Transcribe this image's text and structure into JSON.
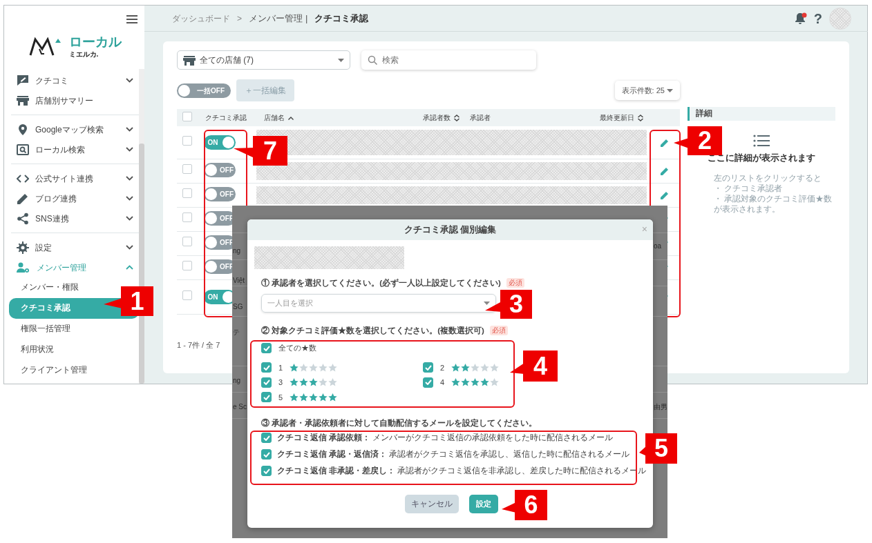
{
  "sidebar": {
    "logo": {
      "main": "ローカル",
      "sub": "ミエルカ."
    },
    "groups": [
      [
        {
          "label": "クチコミ",
          "kind": "menu",
          "expanded": false
        },
        {
          "label": "店舗別サマリー",
          "kind": "link",
          "expanded": false
        }
      ],
      [
        {
          "label": "Googleマップ検索",
          "kind": "menu",
          "expanded": false
        },
        {
          "label": "ローカル検索",
          "kind": "menu",
          "expanded": false
        }
      ],
      [
        {
          "label": "公式サイト連携",
          "kind": "menu",
          "expanded": false
        },
        {
          "label": "ブログ連携",
          "kind": "menu",
          "expanded": false
        },
        {
          "label": "SNS連携",
          "kind": "menu",
          "expanded": false
        }
      ],
      [
        {
          "label": "設定",
          "kind": "menu",
          "expanded": false
        },
        {
          "label": "メンバー管理",
          "kind": "menu",
          "expanded": true
        }
      ]
    ],
    "submenu": [
      {
        "label": "メンバー・権限",
        "selected": false
      },
      {
        "label": "クチコミ承認",
        "selected": true
      },
      {
        "label": "権限一括管理",
        "selected": false
      },
      {
        "label": "利用状況",
        "selected": false
      },
      {
        "label": "クライアント管理",
        "selected": false
      }
    ]
  },
  "header": {
    "breadcrumb": [
      {
        "label": "ダッシュボード"
      },
      {
        "label": "メンバー管理"
      }
    ],
    "separator": ">",
    "divider": "|",
    "current": "クチコミ承認",
    "has_notification": true,
    "help": "?"
  },
  "toolbar": {
    "store_select": "全ての店舗 (7)",
    "search": {
      "placeholder": "検索"
    },
    "bulk_toggle": {
      "label": "一括OFF",
      "on": false
    },
    "bulk_edit": {
      "label": "＋一括編集",
      "disabled": true
    },
    "page_size": "表示件数: 25"
  },
  "table": {
    "all_checked": false,
    "columns": [
      {
        "label": "クチコミ承認"
      },
      {
        "label": "店舗名"
      },
      {
        "label": "承認者数"
      },
      {
        "label": "承認者"
      },
      {
        "label": "最終更新日"
      }
    ],
    "rows": [
      {
        "checked": false,
        "approval": {
          "label": "ON",
          "on": true
        }
      },
      {
        "checked": false,
        "approval": {
          "label": "OFF",
          "on": false
        }
      },
      {
        "checked": false,
        "approval": {
          "label": "OFF",
          "on": false
        }
      },
      {
        "checked": false,
        "approval": {
          "label": "OFF",
          "on": false
        }
      },
      {
        "checked": false,
        "approval": {
          "label": "OFF",
          "on": false
        }
      },
      {
        "checked": false,
        "approval": {
          "label": "OFF",
          "on": false
        }
      },
      {
        "checked": false,
        "approval": {
          "label": "ON",
          "on": true
        }
      }
    ],
    "footer": "1 - 7件 / 全 7"
  },
  "detail": {
    "title": "詳細",
    "message": "ここに詳細が表示されます",
    "hint": [
      "左のリストをクリックすると",
      "・ クチコミ承認者",
      "・ 承認対象のクチコミ評価★数",
      "が表示されます。"
    ]
  },
  "backdrop": {
    "left": [
      "ng",
      "Việt",
      "SG",
      "テ",
      "ng",
      "e Sc"
    ],
    "right": [
      "oa",
      "由男"
    ]
  },
  "modal": {
    "title": "クチコミ承認 個別編集",
    "close": "×",
    "approver": {
      "heading": "① 承認者を選択してください。(必ず一人以上設定してください)",
      "badge": "必須",
      "placeholder": "一人目を選択"
    },
    "rating": {
      "heading": "② 対象クチコミ評価★数を選択してください。(複数選択可)",
      "badge": "必須",
      "all": {
        "label": "全ての★数",
        "checked": true
      },
      "options": [
        {
          "label": "1",
          "checked": true,
          "stars": 1
        },
        {
          "label": "2",
          "checked": true,
          "stars": 2
        },
        {
          "label": "3",
          "checked": true,
          "stars": 3
        },
        {
          "label": "4",
          "checked": true,
          "stars": 4
        },
        {
          "label": "5",
          "checked": true,
          "stars": 5
        }
      ]
    },
    "mail": {
      "heading": "③ 承認者・承認依頼者に対して自動配信するメールを設定してください。",
      "options": [
        {
          "title": "クチコミ返信 承認依頼：",
          "description": "メンバーがクチコミ返信の承認依頼をした時に配信されるメール",
          "checked": true
        },
        {
          "title": "クチコミ返信 承認・返信済：",
          "description": "承認者がクチコミ返信を承認し、返信した時に配信されるメール",
          "checked": true
        },
        {
          "title": "クチコミ返信 非承認・差戻し：",
          "description": "承認者がクチコミ返信を非承認し、差戻した時に配信されるメール",
          "checked": true
        }
      ]
    },
    "buttons": {
      "cancel": "キャンセル",
      "ok": "設定"
    }
  },
  "callouts": [
    {
      "number": "1"
    },
    {
      "number": "2"
    },
    {
      "number": "3"
    },
    {
      "number": "4"
    },
    {
      "number": "5"
    },
    {
      "number": "6"
    },
    {
      "number": "7"
    }
  ]
}
